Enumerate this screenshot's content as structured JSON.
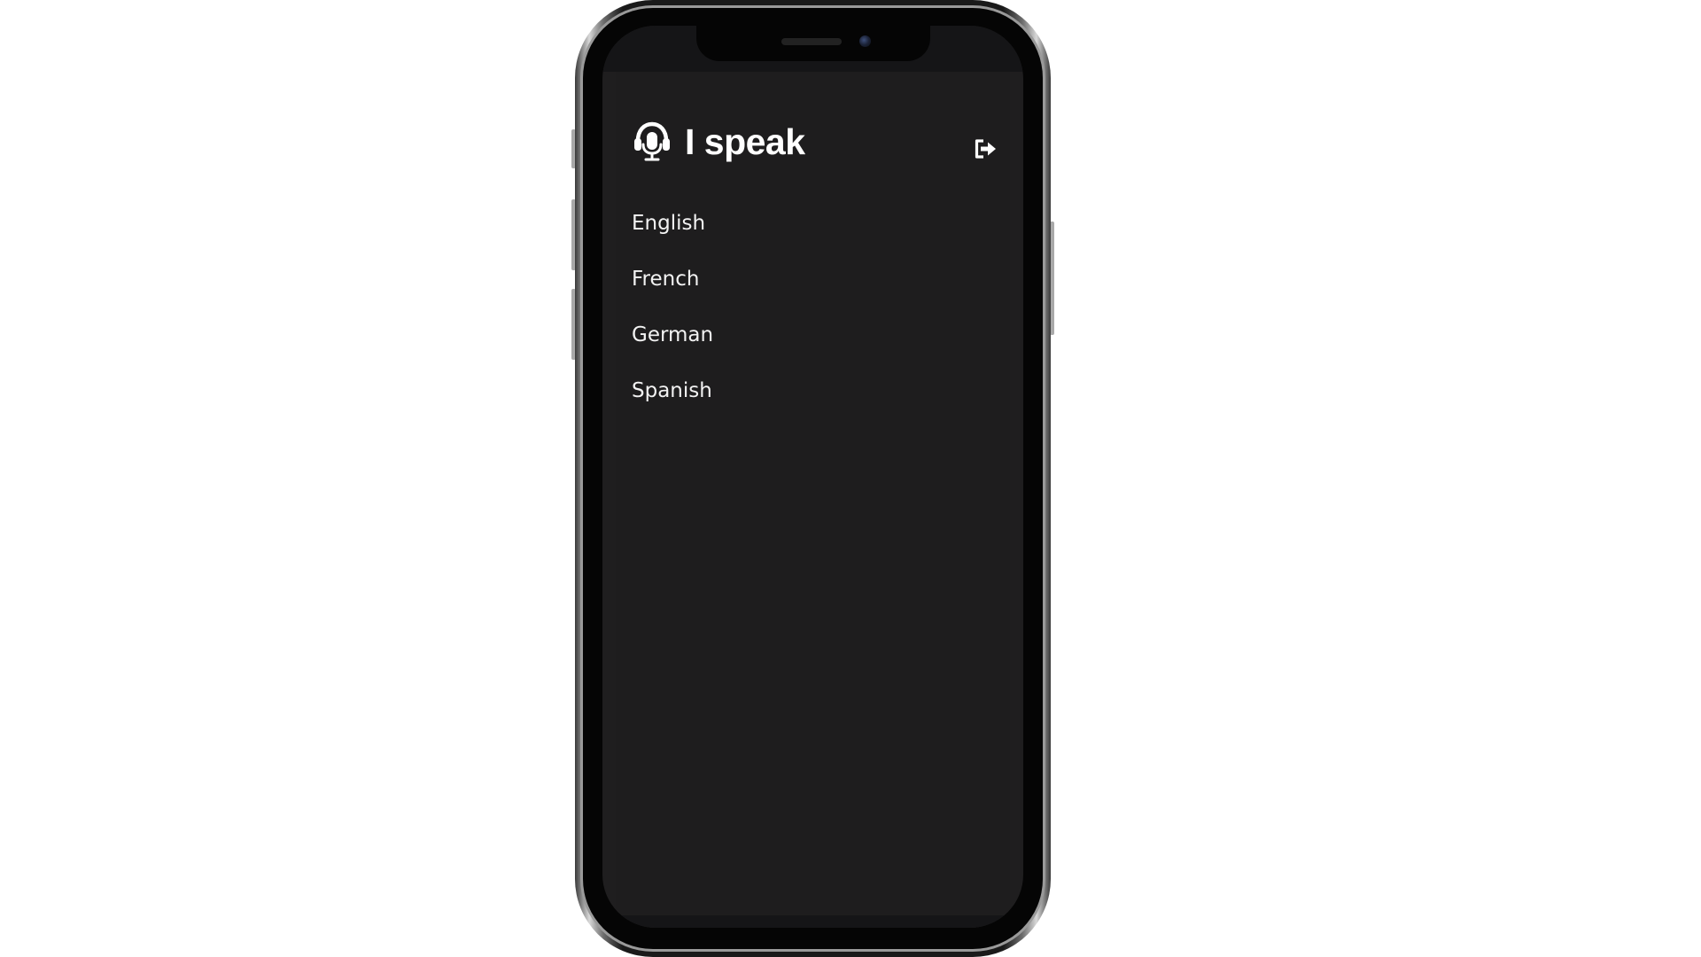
{
  "app": {
    "title": "I speak",
    "logo_icon": "headset-microphone-icon",
    "logout_icon": "logout-icon"
  },
  "languages": {
    "items": [
      {
        "label": "English"
      },
      {
        "label": "French"
      },
      {
        "label": "German"
      },
      {
        "label": "Spanish"
      }
    ]
  },
  "colors": {
    "background": "#1e1d1e",
    "text": "#ffffff"
  }
}
